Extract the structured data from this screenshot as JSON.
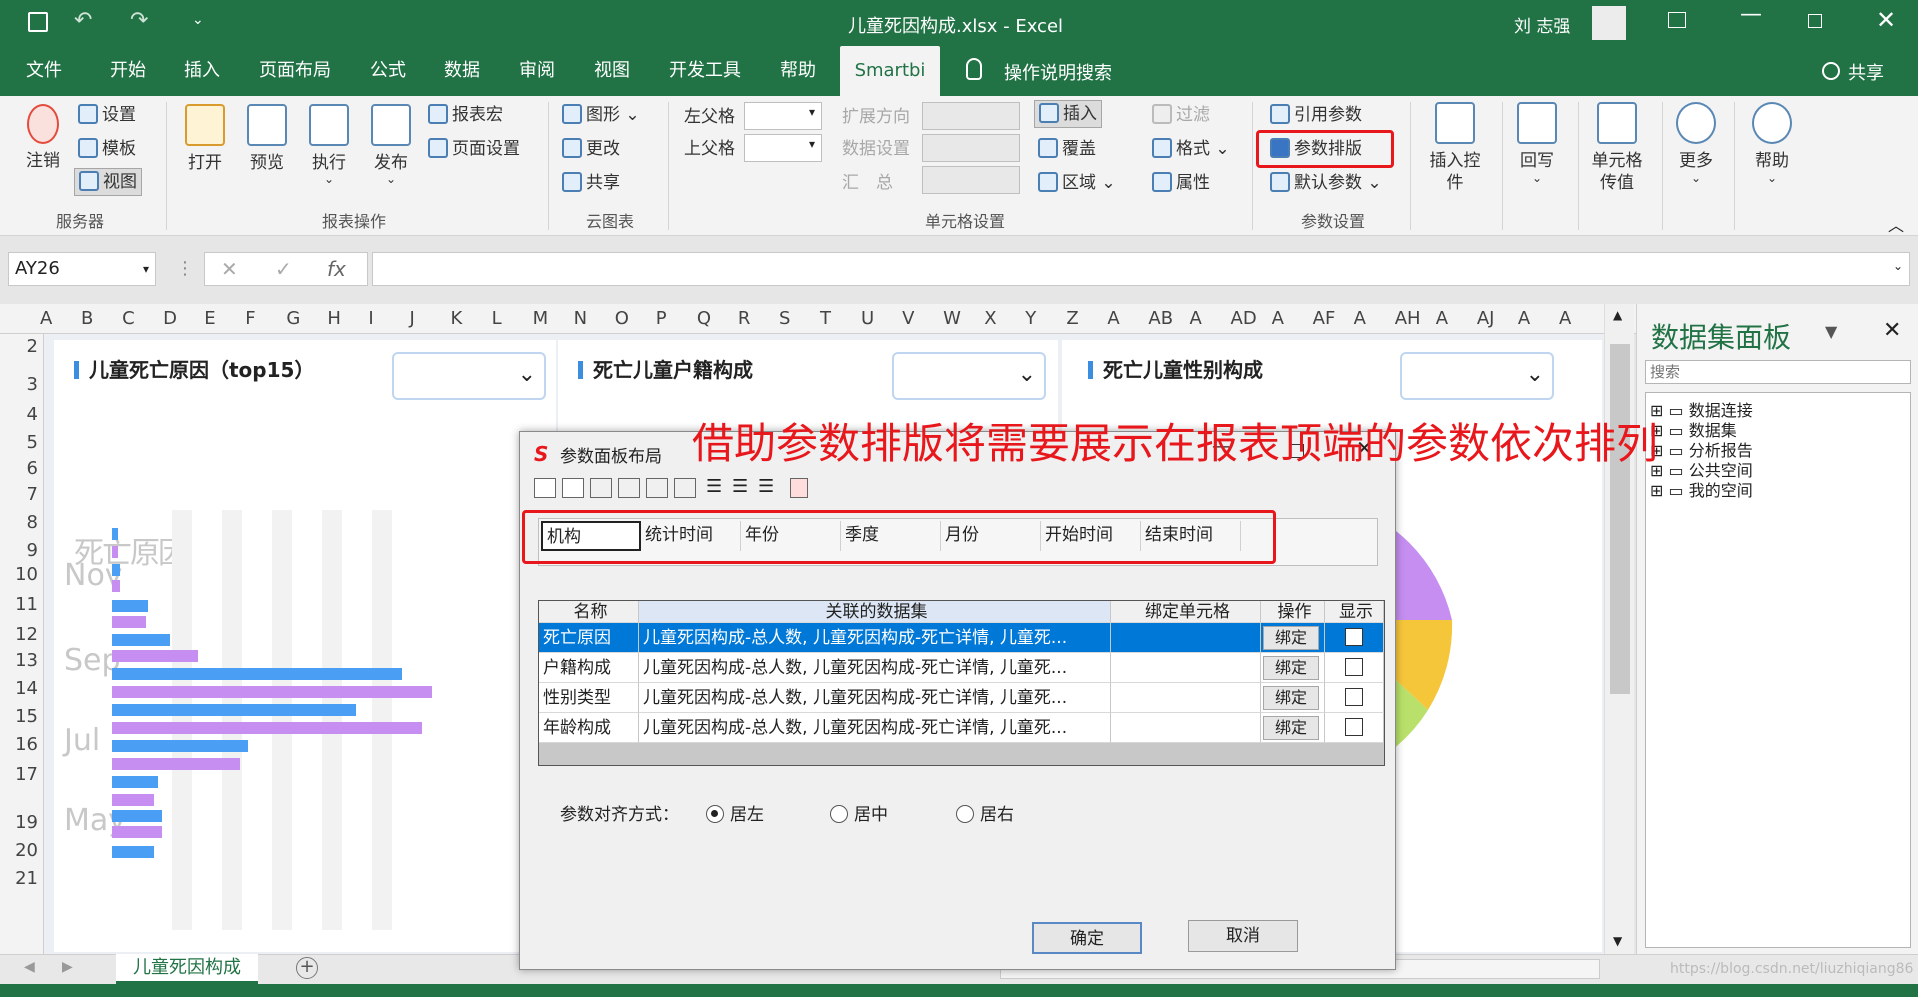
{
  "titlebar": {
    "doc_title": "儿童死因构成.xlsx  -  Excel",
    "user": "刘 志强"
  },
  "menu": {
    "tabs": [
      "文件",
      "开始",
      "插入",
      "页面布局",
      "公式",
      "数据",
      "审阅",
      "视图",
      "开发工具",
      "帮助",
      "Smartbi"
    ],
    "tell_me": "操作说明搜索",
    "share": "共享"
  },
  "ribbon": {
    "server": {
      "logout": "注销",
      "settings": "设置",
      "template": "模板",
      "view": "视图",
      "group": "服务器"
    },
    "report": {
      "open": "打开",
      "preview": "预览",
      "execute": "执行",
      "publish": "发布",
      "macro": "报表宏",
      "page_setup": "页面设置",
      "group": "报表操作"
    },
    "cloud": {
      "chart": "图形",
      "change": "更改",
      "share": "共享",
      "group": "云图表"
    },
    "cell": {
      "left_parent": "左父格",
      "up_parent": "上父格",
      "expand_dir": "扩展方向",
      "data_setting": "数据设置",
      "summary": "汇　总",
      "insert": "插入",
      "cover": "覆盖",
      "area": "区域",
      "filter": "过滤",
      "format": "格式",
      "attr": "属性",
      "group": "单元格设置"
    },
    "param": {
      "ref": "引用参数",
      "layout": "参数排版",
      "default": "默认参数",
      "group": "参数设置"
    },
    "big": {
      "insert_ctrl": "插入控件",
      "writeback": "回写",
      "cell_pass": "单元格传值",
      "more": "更多",
      "help": "帮助"
    }
  },
  "formula": {
    "namebox": "AY26",
    "fx": "fx"
  },
  "columns": [
    "A",
    "B",
    "C",
    "D",
    "E",
    "F",
    "G",
    "H",
    "I",
    "J",
    "K",
    "L",
    "M",
    "N",
    "O",
    "P",
    "Q",
    "R",
    "S",
    "T",
    "U",
    "V",
    "W",
    "X",
    "Y",
    "Z",
    "A",
    "AB",
    "A",
    "AD",
    "A",
    "AF",
    "A",
    "AH",
    "A",
    "AJ",
    "A",
    "A"
  ],
  "rows": [
    "2",
    "3",
    "4",
    "5",
    "6",
    "7",
    "8",
    "9",
    "10",
    "11",
    "12",
    "13",
    "14",
    "15",
    "16",
    "17",
    "19",
    "20",
    "21"
  ],
  "panels": [
    {
      "title": "儿童死亡原因（top15）"
    },
    {
      "title": "死亡儿童户籍构成"
    },
    {
      "title": "死亡儿童性别构成"
    }
  ],
  "chart_data": {
    "type": "bar",
    "title": "死亡原因",
    "categories": [
      "Nov",
      "Sep",
      "Jul",
      "May"
    ],
    "ytick_labels": [
      "Nov",
      "Sep",
      "Jul",
      "May"
    ],
    "series": [],
    "note_values": []
  },
  "right_pane": {
    "title": "数据集面板",
    "search_placeholder": "搜索",
    "tree": [
      "数据连接",
      "数据集",
      "分析报告",
      "公共空间",
      "我的空间"
    ]
  },
  "sheet_tab": "儿童死因构成",
  "watermark": "https://blog.csdn.net/liuzhiqiang86",
  "annotation": "借助参数排版将需要展示在报表顶端的参数依次排列",
  "dialog": {
    "title": "参数面板布局",
    "params": [
      "机构",
      "统计时间",
      "年份",
      "季度",
      "月份",
      "开始时间",
      "结束时间"
    ],
    "table_headers": [
      "名称",
      "关联的数据集",
      "绑定单元格",
      "操作",
      "显示"
    ],
    "rows": [
      {
        "name": "死亡原因",
        "dataset": "儿童死因构成-总人数, 儿童死因构成-死亡详情, 儿童死...",
        "cell": "",
        "action": "绑定"
      },
      {
        "name": "户籍构成",
        "dataset": "儿童死因构成-总人数, 儿童死因构成-死亡详情, 儿童死...",
        "cell": "",
        "action": "绑定"
      },
      {
        "name": "性别类型",
        "dataset": "儿童死因构成-总人数, 儿童死因构成-死亡详情, 儿童死...",
        "cell": "",
        "action": "绑定"
      },
      {
        "name": "年龄构成",
        "dataset": "儿童死因构成-总人数, 儿童死因构成-死亡详情, 儿童死...",
        "cell": "",
        "action": "绑定"
      }
    ],
    "align_label": "参数对齐方式：",
    "align_options": [
      "居左",
      "居中",
      "居右"
    ],
    "ok": "确定",
    "cancel": "取消"
  },
  "colors": {
    "excel_green": "#217346",
    "highlight_red": "#e8171c",
    "selection_blue": "#0078d7",
    "bar_blue": "#4a9ff5",
    "bar_purple": "#c58ef0"
  }
}
